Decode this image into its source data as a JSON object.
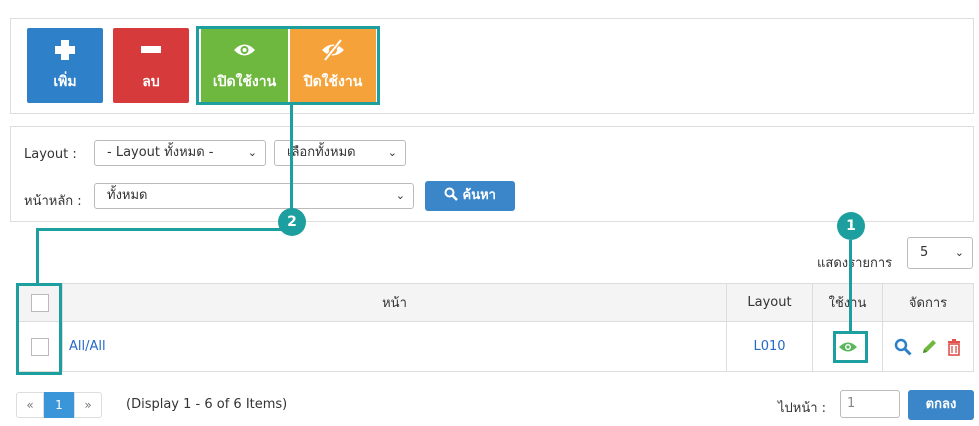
{
  "toolbar": {
    "add_label": "เพิ่ม",
    "delete_label": "ลบ",
    "enable_label": "เปิดใช้งาน",
    "disable_label": "ปิดใช้งาน"
  },
  "filters": {
    "layout_label": "Layout :",
    "layout_value": "- Layout ทั้งหมด -",
    "select_all_value": "เลือกทั้งหมด",
    "main_label": "หน้าหลัก :",
    "main_value": "ทั้งหมด",
    "search_label": "ค้นหา"
  },
  "show": {
    "label": "แสดงรายการ",
    "value": "5"
  },
  "table": {
    "headers": {
      "page": "หน้า",
      "layout": "Layout",
      "active": "ใช้งาน",
      "manage": "จัดการ"
    },
    "rows": [
      {
        "page": "All/All",
        "layout": "L010"
      }
    ]
  },
  "pagination": {
    "prev": "«",
    "current": "1",
    "next": "»",
    "info": "(Display 1 - 6 of 6 Items)",
    "goto_label": "ไปหน้า :",
    "goto_value": "1",
    "ok_label": "ตกลง"
  },
  "callouts": {
    "eye_marker": "1",
    "toolbar_marker": "2"
  },
  "colors": {
    "add": "#2e81c8",
    "delete": "#d63a3a",
    "enable": "#6fb83f",
    "disable": "#f6a23a",
    "callout": "#1d9f9f",
    "primary": "#3a86c8",
    "link": "#2468c8"
  },
  "icons": {
    "add": "plus-icon",
    "delete": "minus-icon",
    "enable": "eye-icon",
    "disable": "eye-slash-icon",
    "search": "search-icon",
    "view": "magnifier-icon",
    "edit": "pencil-icon",
    "trash": "trash-icon"
  }
}
